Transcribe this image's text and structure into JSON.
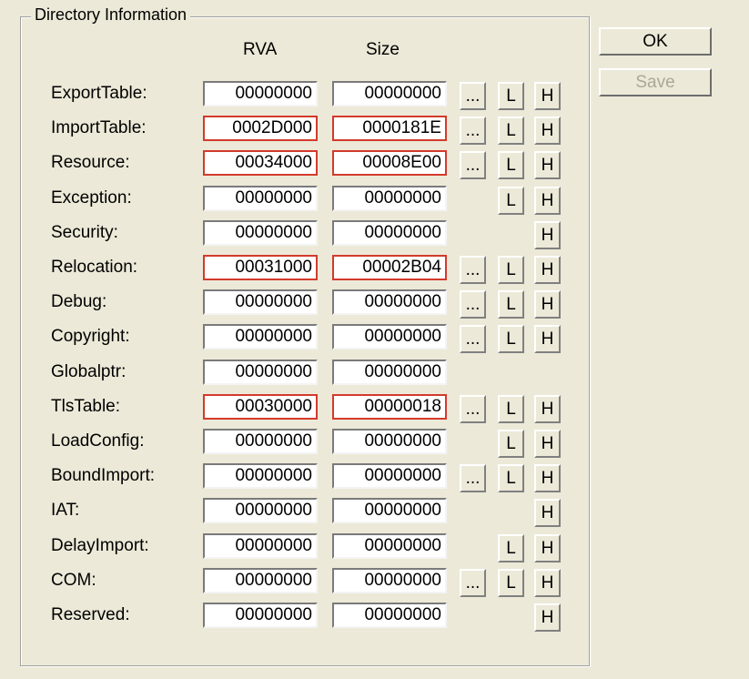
{
  "group": {
    "title": "Directory Information"
  },
  "columns": {
    "rva": "RVA",
    "size": "Size"
  },
  "buttons": {
    "ok": "OK",
    "save": "Save",
    "dots": "...",
    "l": "L",
    "h": "H"
  },
  "rows": [
    {
      "label": "ExportTable:",
      "rva": "00000000",
      "size": "00000000",
      "highlight": false,
      "dots": true,
      "l": true,
      "h": true
    },
    {
      "label": "ImportTable:",
      "rva": "0002D000",
      "size": "0000181E",
      "highlight": true,
      "dots": true,
      "l": true,
      "h": true
    },
    {
      "label": "Resource:",
      "rva": "00034000",
      "size": "00008E00",
      "highlight": true,
      "dots": true,
      "l": true,
      "h": true
    },
    {
      "label": "Exception:",
      "rva": "00000000",
      "size": "00000000",
      "highlight": false,
      "dots": false,
      "l": true,
      "h": true
    },
    {
      "label": "Security:",
      "rva": "00000000",
      "size": "00000000",
      "highlight": false,
      "dots": false,
      "l": false,
      "h": true
    },
    {
      "label": "Relocation:",
      "rva": "00031000",
      "size": "00002B04",
      "highlight": true,
      "dots": true,
      "l": true,
      "h": true
    },
    {
      "label": "Debug:",
      "rva": "00000000",
      "size": "00000000",
      "highlight": false,
      "dots": true,
      "l": true,
      "h": true
    },
    {
      "label": "Copyright:",
      "rva": "00000000",
      "size": "00000000",
      "highlight": false,
      "dots": true,
      "l": true,
      "h": true
    },
    {
      "label": "Globalptr:",
      "rva": "00000000",
      "size": "00000000",
      "highlight": false,
      "dots": false,
      "l": false,
      "h": false
    },
    {
      "label": "TlsTable:",
      "rva": "00030000",
      "size": "00000018",
      "highlight": true,
      "dots": true,
      "l": true,
      "h": true
    },
    {
      "label": "LoadConfig:",
      "rva": "00000000",
      "size": "00000000",
      "highlight": false,
      "dots": false,
      "l": true,
      "h": true
    },
    {
      "label": "BoundImport:",
      "rva": "00000000",
      "size": "00000000",
      "highlight": false,
      "dots": true,
      "l": true,
      "h": true
    },
    {
      "label": "IAT:",
      "rva": "00000000",
      "size": "00000000",
      "highlight": false,
      "dots": false,
      "l": false,
      "h": true
    },
    {
      "label": "DelayImport:",
      "rva": "00000000",
      "size": "00000000",
      "highlight": false,
      "dots": false,
      "l": true,
      "h": true
    },
    {
      "label": "COM:",
      "rva": "00000000",
      "size": "00000000",
      "highlight": false,
      "dots": true,
      "l": true,
      "h": true
    },
    {
      "label": "Reserved:",
      "rva": "00000000",
      "size": "00000000",
      "highlight": false,
      "dots": false,
      "l": false,
      "h": true
    }
  ]
}
